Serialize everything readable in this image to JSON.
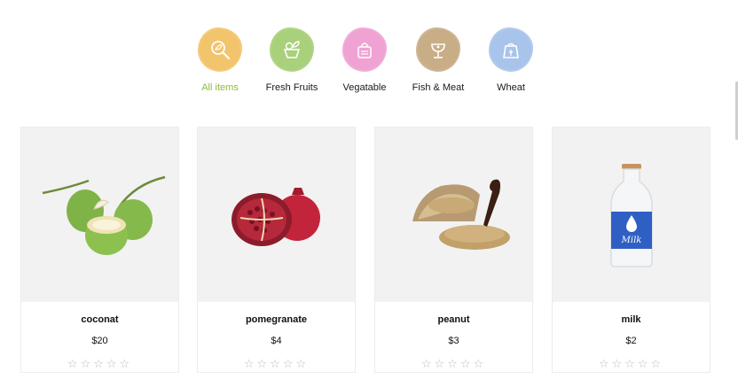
{
  "categories": [
    {
      "label": "All items",
      "icon": "magnifier-leaf-icon",
      "color": "#f2c46c",
      "active": true
    },
    {
      "label": "Fresh Fruits",
      "icon": "fruit-basket-icon",
      "color": "#a9cf7a",
      "active": false
    },
    {
      "label": "Vegatable",
      "icon": "vegetable-icon",
      "color": "#efa2d3",
      "active": false
    },
    {
      "label": "Fish & Meat",
      "icon": "fish-meat-icon",
      "color": "#c8ad86",
      "active": false
    },
    {
      "label": "Wheat",
      "icon": "wheat-sack-icon",
      "color": "#a9c4ea",
      "active": false
    }
  ],
  "products": [
    {
      "name": "coconat",
      "price": "$20",
      "rating": 0,
      "max_rating": 5,
      "image": "coconut-image"
    },
    {
      "name": "pomegranate",
      "price": "$4",
      "rating": 0,
      "max_rating": 5,
      "image": "pomegranate-image"
    },
    {
      "name": "peanut",
      "price": "$3",
      "rating": 0,
      "max_rating": 5,
      "image": "peanut-sack-image"
    },
    {
      "name": "milk",
      "price": "$2",
      "rating": 0,
      "max_rating": 5,
      "image": "milk-bottle-image"
    }
  ],
  "milk_label": "Milk",
  "star_glyph": "☆"
}
